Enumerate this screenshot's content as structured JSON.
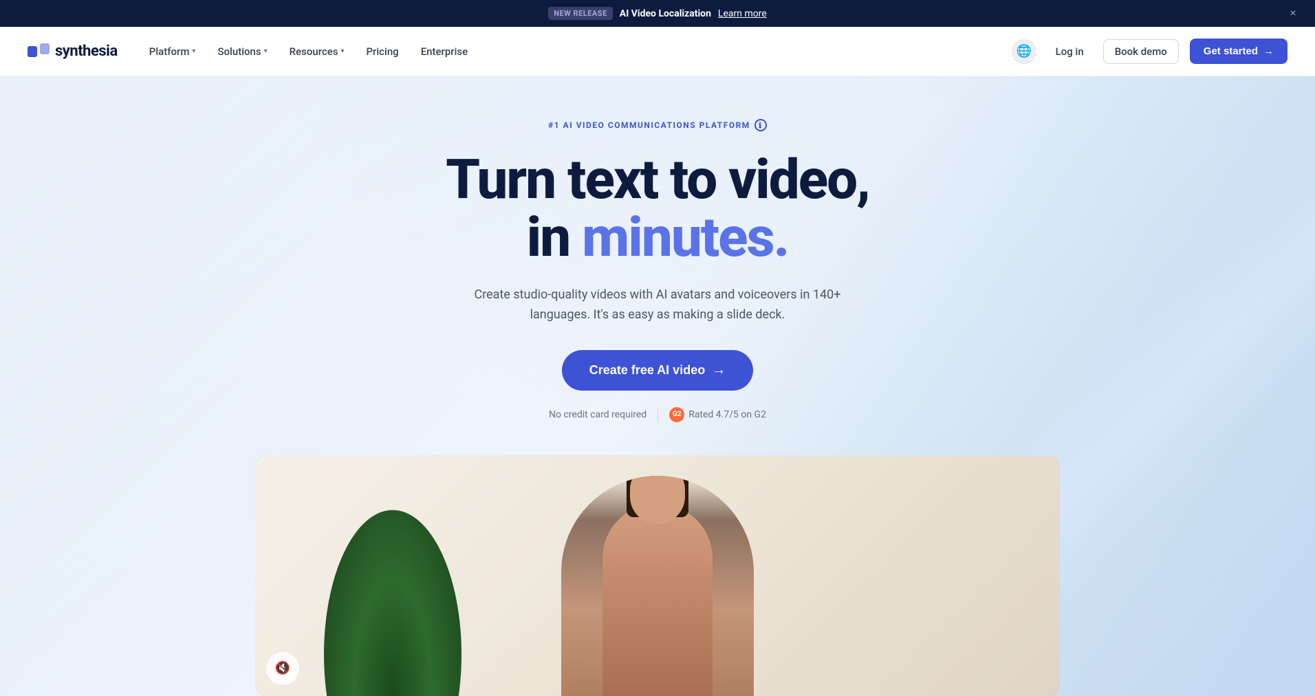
{
  "announcement": {
    "badge": "NEW RELEASE",
    "title": "AI Video Localization",
    "link_text": "Learn more",
    "close_label": "×"
  },
  "navbar": {
    "logo_text": "synthesia",
    "nav_items": [
      {
        "label": "Platform",
        "has_dropdown": true
      },
      {
        "label": "Solutions",
        "has_dropdown": true
      },
      {
        "label": "Resources",
        "has_dropdown": true
      },
      {
        "label": "Pricing",
        "has_dropdown": false
      },
      {
        "label": "Enterprise",
        "has_dropdown": false
      }
    ],
    "globe_label": "🌐",
    "login_label": "Log in",
    "demo_label": "Book demo",
    "get_started_label": "Get started",
    "get_started_arrow": "→"
  },
  "hero": {
    "badge_text": "#1 AI VIDEO COMMUNICATIONS PLATFORM",
    "badge_icon": "ℹ",
    "title_part1": "Turn text to video,",
    "title_part2": "in ",
    "title_highlight": "minutes.",
    "subtitle": "Create studio-quality videos with AI avatars and voiceovers in 140+ languages. It's as easy as making a slide deck.",
    "cta_label": "Create free AI video",
    "cta_arrow": "→",
    "social_proof_left": "No credit card required",
    "social_proof_right": "Rated 4.7/5 on G2",
    "g2_icon": "G2",
    "mute_icon": "🔇"
  }
}
